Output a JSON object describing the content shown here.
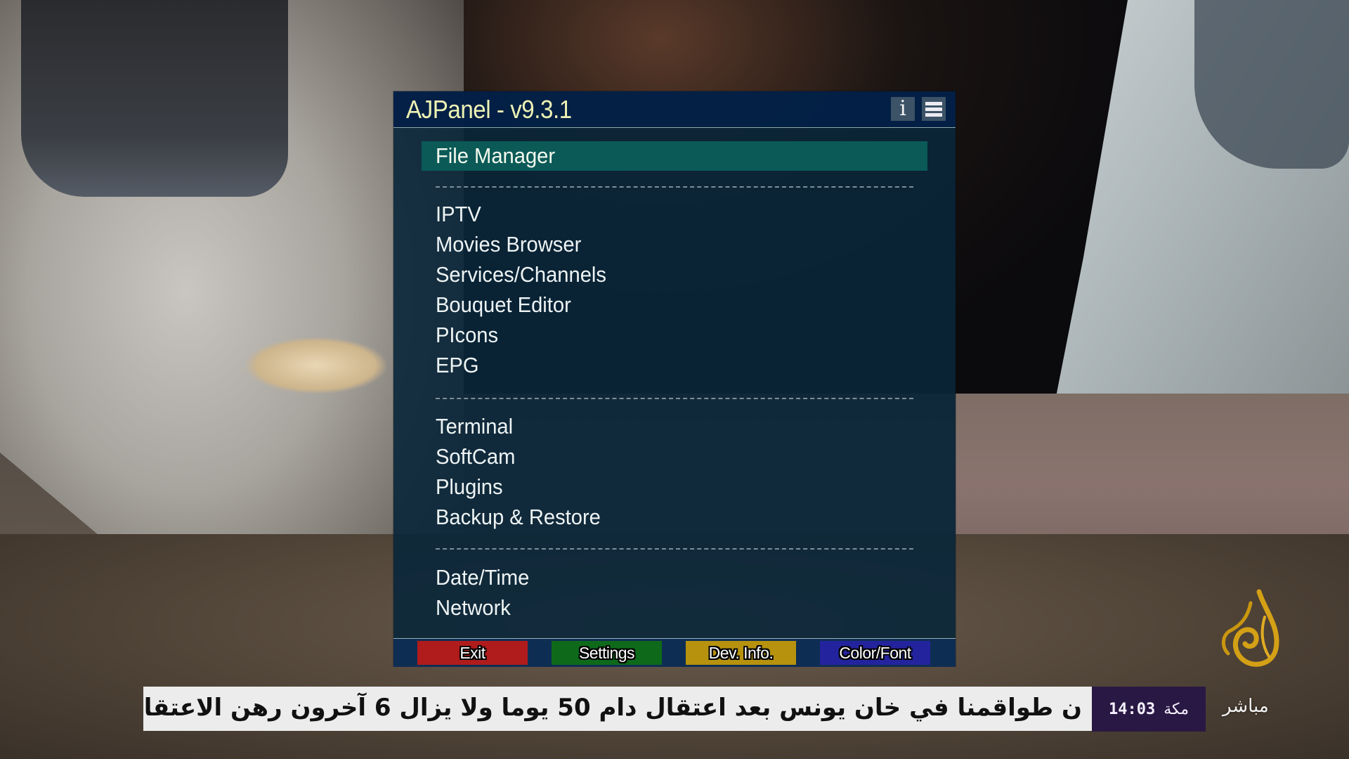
{
  "panel": {
    "title": "AJPanel - v9.3.1",
    "header_buttons": [
      {
        "name": "info",
        "icon": "info-icon",
        "glyph": "i"
      },
      {
        "name": "menu",
        "icon": "hamburger-menu-icon"
      }
    ],
    "selected_item": "File Manager",
    "groups": [
      {
        "items": [
          "File Manager"
        ]
      },
      {
        "items": [
          "IPTV",
          "Movies Browser",
          "Services/Channels",
          "Bouquet Editor",
          "PIcons",
          "EPG"
        ]
      },
      {
        "items": [
          "Terminal",
          "SoftCam",
          "Plugins",
          "Backup & Restore"
        ]
      },
      {
        "items": [
          "Date/Time",
          "Network"
        ]
      }
    ],
    "footer_buttons": [
      {
        "label": "Exit",
        "color_key": "red",
        "color": "#b01c1c"
      },
      {
        "label": "Settings",
        "color_key": "green",
        "color": "#0e6a1a"
      },
      {
        "label": "Dev. Info.",
        "color_key": "yellow",
        "color": "#b6920e"
      },
      {
        "label": "Color/Font",
        "color_key": "blue",
        "color": "#24239e"
      }
    ],
    "colors": {
      "title_text": "#eef3b4",
      "highlight": "#0b5a58",
      "panel_bg": "#09263a"
    }
  },
  "broadcast": {
    "ticker_text": "ن طواقمنا في خان يونس بعد اعتقال دام 50 يوما ولا يزال 6 آخرون رهن الاعتقال",
    "city": "مكة",
    "time": "14:03",
    "channel_logo": "al-jazeera-logo",
    "channel_sub": "مباشر",
    "colors": {
      "logo_gold": "#d4a015",
      "timebox_bg": "#2a1844"
    }
  }
}
